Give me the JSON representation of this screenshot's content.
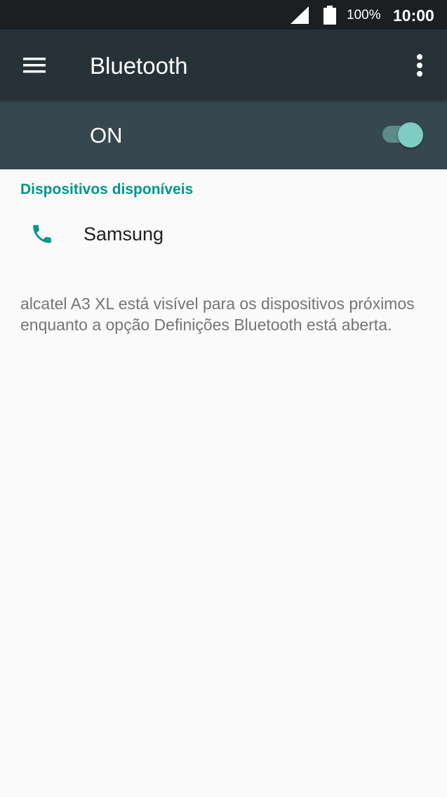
{
  "status_bar": {
    "battery_percent": "100%",
    "time": "10:00",
    "icons": [
      "signal-icon",
      "battery-icon"
    ]
  },
  "app_bar": {
    "title": "Bluetooth",
    "menu_icon": "menu-icon",
    "more_icon": "more-vert-icon"
  },
  "bluetooth_switch": {
    "label": "ON",
    "checked": true,
    "track_color": "#5b8c88",
    "thumb_color": "#80cbc4"
  },
  "available_devices": {
    "header": "Dispositivos disponíveis",
    "devices": [
      {
        "name": "Samsung",
        "icon": "phone-icon"
      }
    ]
  },
  "visibility_note": "alcatel A3 XL está visível para os dispositivos próximos enquanto a opção Definições Bluetooth está aberta.",
  "colors": {
    "status_bar": "#1b1f22",
    "app_bar": "#263238",
    "switch_bar": "#37474f",
    "accent": "#009688",
    "background": "#fafafa"
  }
}
